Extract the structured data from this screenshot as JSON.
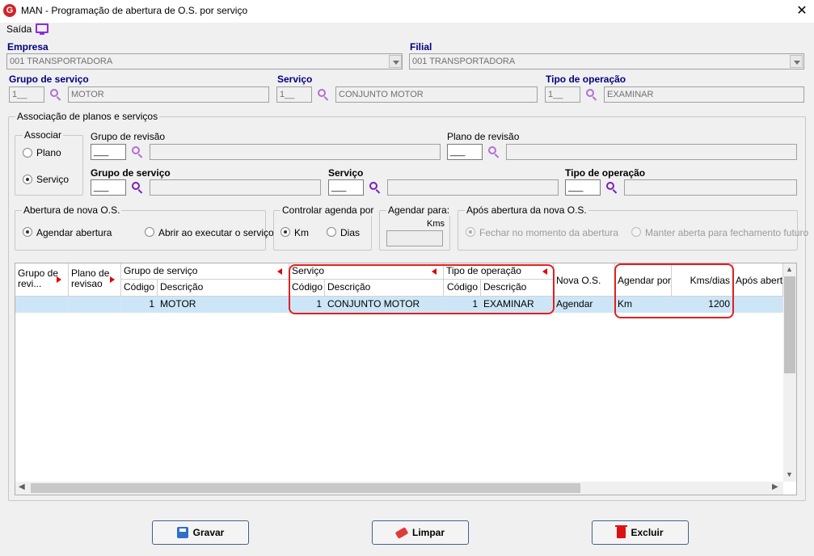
{
  "window": {
    "title": "MAN - Programação de abertura de O.S. por serviço",
    "logo": "G",
    "close": "✕"
  },
  "menu": {
    "exit_label": "Saída"
  },
  "top": {
    "empresa_label": "Empresa",
    "empresa_value": "001 TRANSPORTADORA",
    "filial_label": "Filial",
    "filial_value": "001 TRANSPORTADORA",
    "grupo_label": "Grupo de serviço",
    "grupo_code": "1__",
    "grupo_desc": "MOTOR",
    "servico_label": "Serviço",
    "servico_code": "1__",
    "servico_desc": "CONJUNTO MOTOR",
    "tipo_label": "Tipo de operação",
    "tipo_code": "1__",
    "tipo_desc": "EXAMINAR"
  },
  "assoc": {
    "title": "Associação de planos e serviços",
    "associar_title": "Associar",
    "opt_plano": "Plano",
    "opt_servico": "Serviço",
    "selected": "Serviço",
    "grupo_revisao_label": "Grupo de revisão",
    "grupo_revisao_code": "___",
    "plano_revisao_label": "Plano de revisão",
    "plano_revisao_code": "___",
    "grupo_servico_label": "Grupo de serviço",
    "grupo_servico_code": "___",
    "servico_label": "Serviço",
    "servico_code": "___",
    "tipo_operacao_label": "Tipo de operação",
    "tipo_operacao_code": "___"
  },
  "abertura": {
    "title": "Abertura de nova O.S.",
    "opt_agendar": "Agendar abertura",
    "opt_abrir": "Abrir ao executar o serviço",
    "selected": "Agendar abertura"
  },
  "controlar": {
    "title": "Controlar agenda por",
    "opt_km": "Km",
    "opt_dias": "Dias",
    "selected": "Km"
  },
  "agendar_para": {
    "title": "Agendar para:",
    "unit": "Kms"
  },
  "apos": {
    "title": "Após abertura da nova O.S.",
    "opt_fechar": "Fechar no momento da abertura",
    "opt_manter": "Manter aberta para fechamento futuro",
    "selected": "Fechar no momento da abertura"
  },
  "grid": {
    "headers": {
      "grupo_revisao": "Grupo de revi...",
      "plano_revisao": "Plano de revisao",
      "grupo_servico": "Grupo de serviço",
      "servico": "Serviço",
      "tipo_operacao": "Tipo de operação",
      "nova_os": "Nova O.S.",
      "agendar_por": "Agendar por",
      "kms_dias": "Kms/dias",
      "apos_abertura": "Após abertu",
      "codigo": "Código",
      "descricao": "Descrição"
    },
    "rows": [
      {
        "grupo_revisao": "",
        "plano_revisao": "",
        "grupo_servico_codigo": "1",
        "grupo_servico_descricao": "MOTOR",
        "servico_codigo": "1",
        "servico_descricao": "CONJUNTO MOTOR",
        "tipo_operacao_codigo": "1",
        "tipo_operacao_descricao": "EXAMINAR",
        "nova_os": "Agendar",
        "agendar_por": "Km",
        "kms_dias": "1200",
        "apos_abertura": ""
      }
    ]
  },
  "buttons": {
    "gravar": "Gravar",
    "limpar": "Limpar",
    "excluir": "Excluir"
  },
  "colors": {
    "accent_red": "#e02020",
    "label_blue": "#000080",
    "selection": "#cde6f7",
    "button_border": "#3c5a8a"
  }
}
